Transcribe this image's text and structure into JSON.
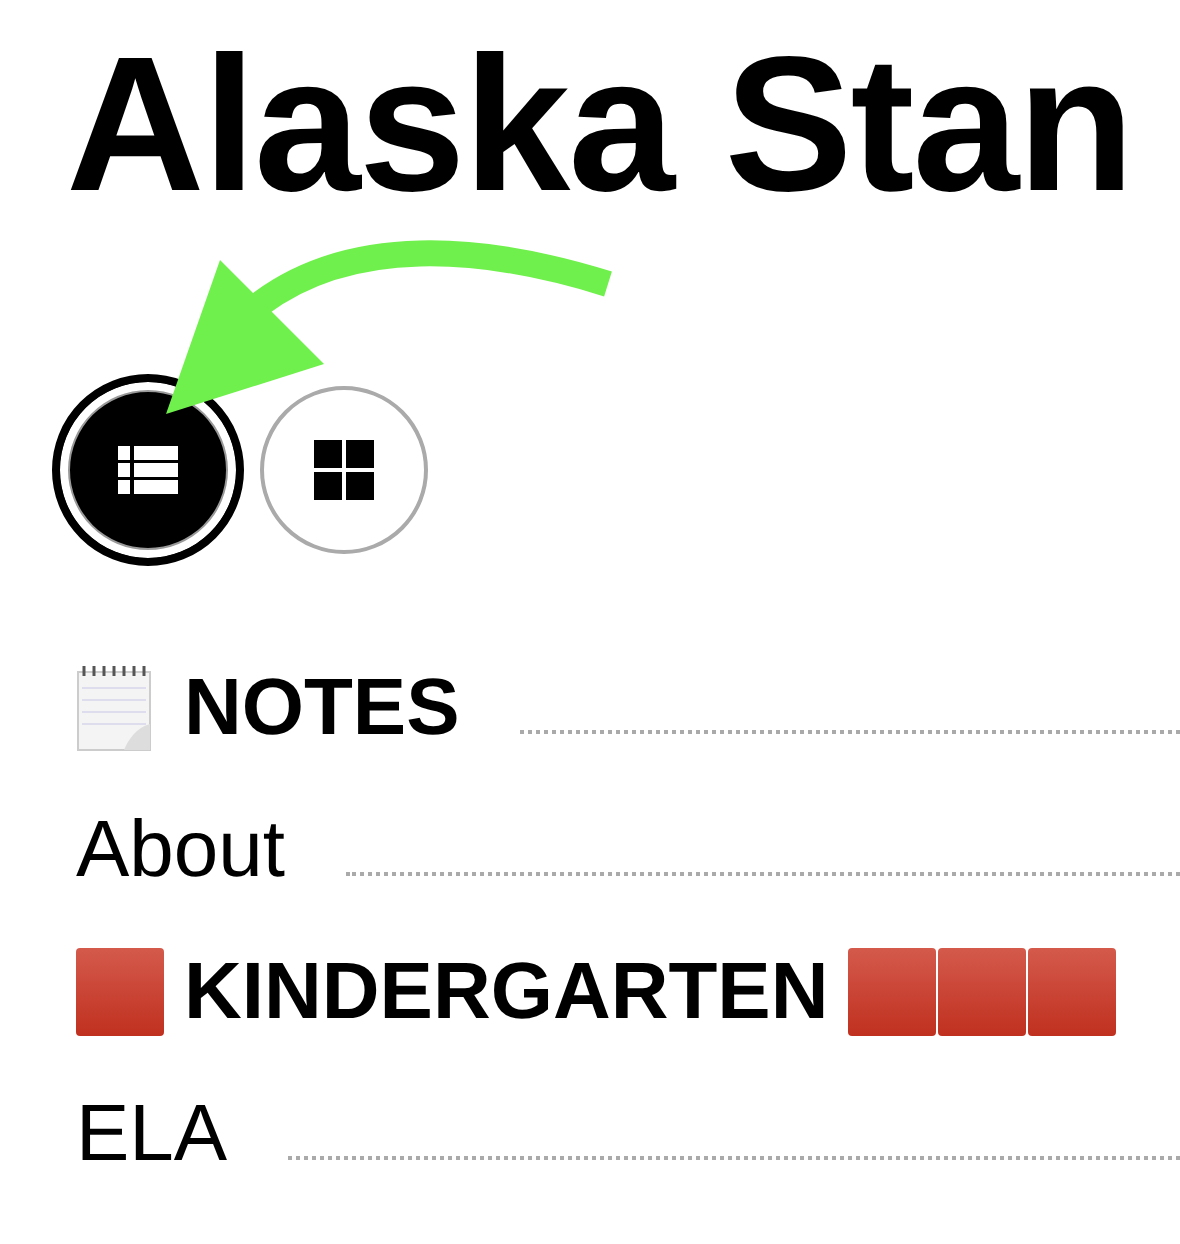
{
  "title": "Alaska Stan",
  "view_toggle": [
    {
      "kind": "list",
      "selected": true
    },
    {
      "kind": "grid",
      "selected": false
    }
  ],
  "entries": [
    {
      "kind": "notes",
      "label": "NOTES"
    },
    {
      "kind": "link",
      "label": "About"
    },
    {
      "kind": "grade",
      "label": "KINDERGARTEN"
    },
    {
      "kind": "link",
      "label": "ELA"
    }
  ]
}
